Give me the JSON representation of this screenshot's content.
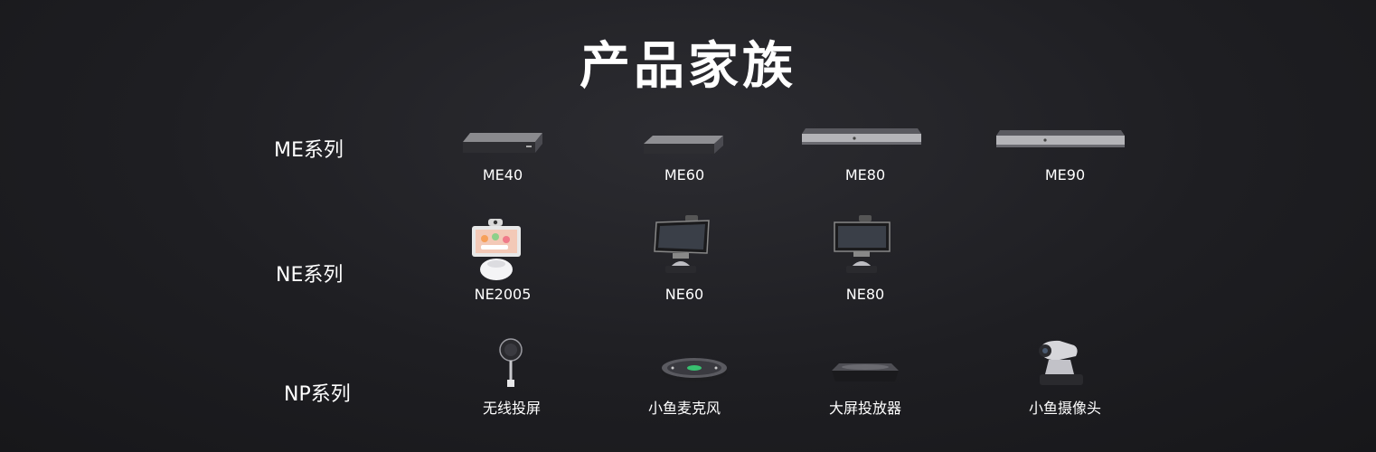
{
  "title": "产品家族",
  "series": [
    {
      "label": "ME系列",
      "items": [
        {
          "name": "ME40",
          "icon": "box-device-icon"
        },
        {
          "name": "ME60",
          "icon": "box-device-icon"
        },
        {
          "name": "ME80",
          "icon": "rack-device-icon"
        },
        {
          "name": "ME90",
          "icon": "rack-device-icon"
        }
      ]
    },
    {
      "label": "NE系列",
      "items": [
        {
          "name": "NE2005",
          "icon": "tablet-robot-icon"
        },
        {
          "name": "NE60",
          "icon": "tablet-stand-icon"
        },
        {
          "name": "NE80",
          "icon": "tablet-stand-icon"
        }
      ]
    },
    {
      "label": "NP系列",
      "items": [
        {
          "name": "无线投屏",
          "icon": "wireless-dongle-icon"
        },
        {
          "name": "小鱼麦克风",
          "icon": "microphone-pod-icon"
        },
        {
          "name": "大屏投放器",
          "icon": "media-box-icon"
        },
        {
          "name": "小鱼摄像头",
          "icon": "ptz-camera-icon"
        }
      ]
    }
  ]
}
